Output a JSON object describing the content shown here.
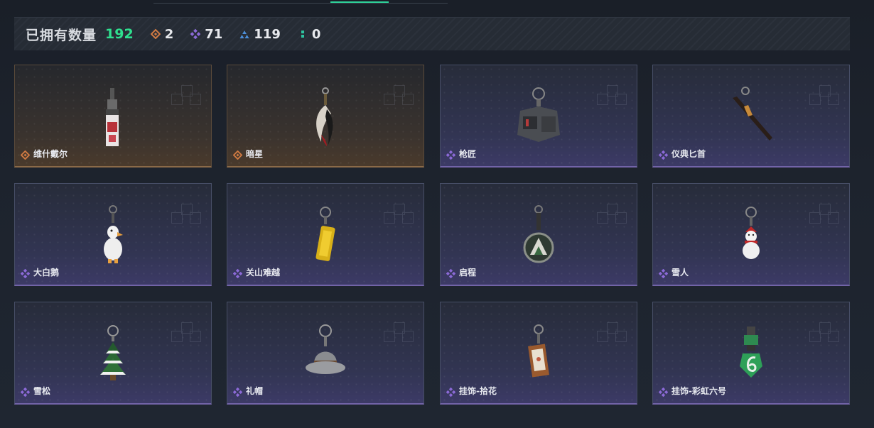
{
  "summary": {
    "title": "已拥有数量",
    "total": "192",
    "stats": [
      {
        "icon": "orange-diamond-icon",
        "color": "#d07a42",
        "value": "2"
      },
      {
        "icon": "purple-clover-icon",
        "color": "#8c6ad8",
        "value": "71"
      },
      {
        "icon": "blue-triangle-icon",
        "color": "#4c8ed8",
        "value": "119"
      },
      {
        "icon": "teal-dots-icon",
        "color": "#2ec4a0",
        "value": "0"
      }
    ]
  },
  "items": [
    {
      "name": "维什戴尔",
      "rarity": "orange",
      "icon": "tall-tag-charm-icon"
    },
    {
      "name": "暗星",
      "rarity": "orange",
      "icon": "feather-charm-icon"
    },
    {
      "name": "枪匠",
      "rarity": "purple",
      "icon": "mechanical-charm-icon"
    },
    {
      "name": "仪典匕首",
      "rarity": "purple",
      "icon": "dagger-icon"
    },
    {
      "name": "大白鹅",
      "rarity": "purple",
      "icon": "goose-charm-icon"
    },
    {
      "name": "关山难越",
      "rarity": "purple",
      "icon": "gold-bar-charm-icon"
    },
    {
      "name": "启程",
      "rarity": "purple",
      "icon": "medallion-charm-icon"
    },
    {
      "name": "雪人",
      "rarity": "purple",
      "icon": "snowman-charm-icon"
    },
    {
      "name": "雪松",
      "rarity": "purple",
      "icon": "pine-tree-charm-icon"
    },
    {
      "name": "礼帽",
      "rarity": "purple",
      "icon": "hat-charm-icon"
    },
    {
      "name": "挂饰-拾花",
      "rarity": "purple",
      "icon": "frame-charm-icon"
    },
    {
      "name": "挂饰-彩虹六号",
      "rarity": "purple",
      "icon": "six-charm-icon"
    }
  ]
}
